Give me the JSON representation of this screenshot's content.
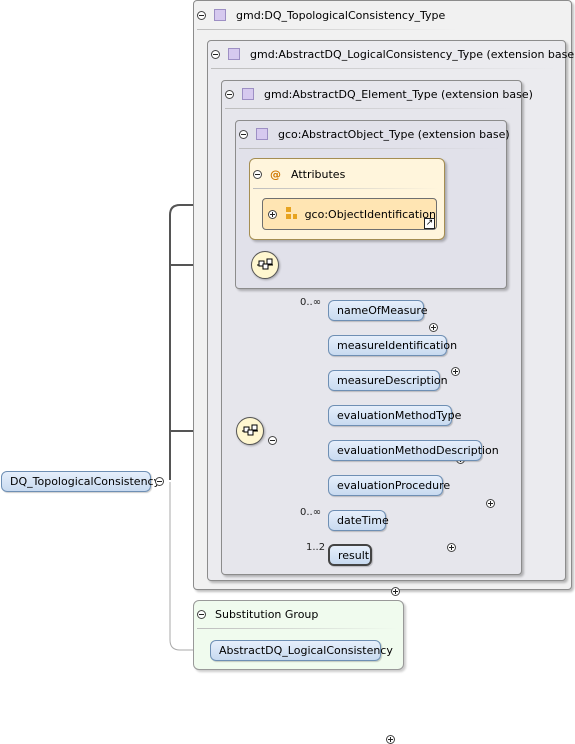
{
  "root_element": {
    "label": "DQ_TopologicalConsistency"
  },
  "types": {
    "t1": "gmd:DQ_TopologicalConsistency_Type",
    "t2": "gmd:AbstractDQ_LogicalConsistency_Type (extension base)",
    "t3": "gmd:AbstractDQ_Element_Type (extension base)",
    "t4": "gco:AbstractObject_Type (extension base)"
  },
  "attributes": {
    "title": "Attributes",
    "at_symbol": "@",
    "item": "gco:ObjectIdentification"
  },
  "elements": [
    {
      "label": "nameOfMeasure",
      "multiplicity": "0..∞"
    },
    {
      "label": "measureIdentification",
      "multiplicity": ""
    },
    {
      "label": "measureDescription",
      "multiplicity": ""
    },
    {
      "label": "evaluationMethodType",
      "multiplicity": ""
    },
    {
      "label": "evaluationMethodDescription",
      "multiplicity": ""
    },
    {
      "label": "evaluationProcedure",
      "multiplicity": ""
    },
    {
      "label": "dateTime",
      "multiplicity": "0..∞"
    },
    {
      "label": "result",
      "multiplicity": "1..2"
    }
  ],
  "substitution_group": {
    "title": "Substitution Group",
    "member": "AbstractDQ_LogicalConsistency"
  },
  "colors": {
    "element_fill": "#c8daf0",
    "element_border": "#6e8fb4",
    "attribute_fill": "#fff5dc",
    "substitution_fill": "#f0fbee"
  }
}
